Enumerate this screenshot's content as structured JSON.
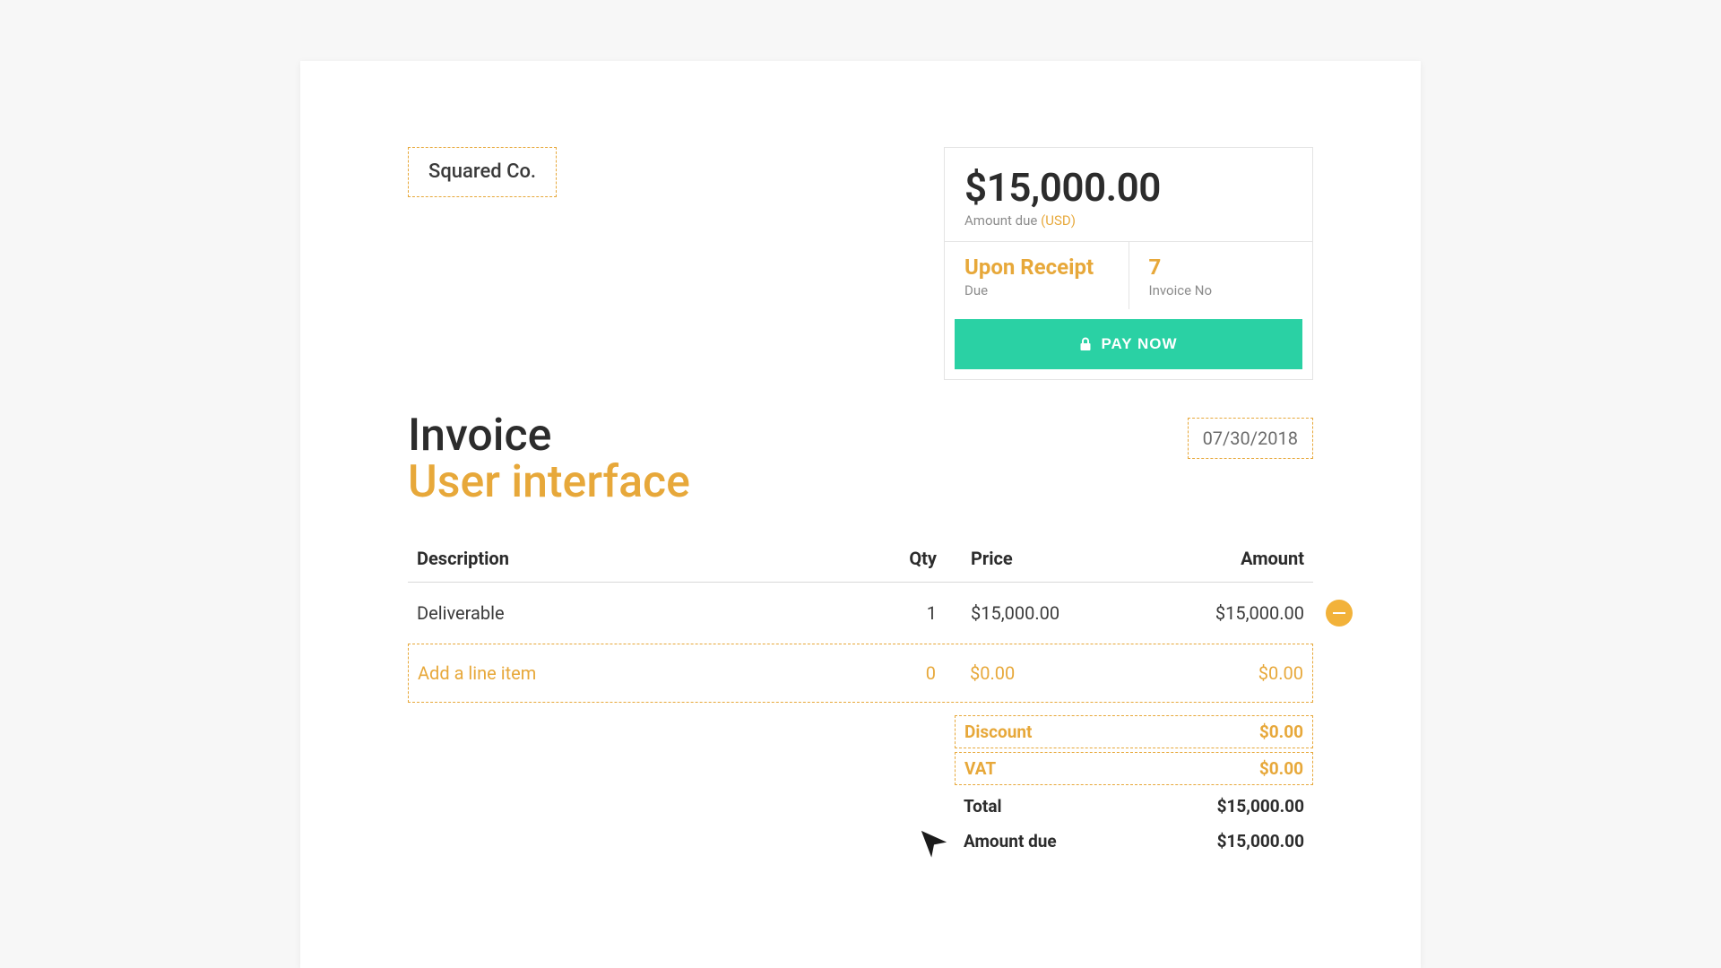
{
  "company_name": "Squared Co.",
  "summary": {
    "amount_big": "$15,000.00",
    "amount_due_label": "Amount due",
    "currency": "(USD)",
    "due_value": "Upon Receipt",
    "due_label": "Due",
    "invoice_no_value": "7",
    "invoice_no_label": "Invoice No",
    "pay_label": "PAY NOW"
  },
  "title": {
    "heading": "Invoice",
    "subheading": "User interface",
    "date": "07/30/2018"
  },
  "table": {
    "headers": {
      "description": "Description",
      "qty": "Qty",
      "price": "Price",
      "amount": "Amount"
    },
    "row": {
      "description": "Deliverable",
      "qty": "1",
      "price": "$15,000.00",
      "amount": "$15,000.00"
    },
    "add": {
      "label": "Add a line item",
      "qty": "0",
      "price": "$0.00",
      "amount": "$0.00"
    }
  },
  "totals": {
    "discount_label": "Discount",
    "discount_value": "$0.00",
    "vat_label": "VAT",
    "vat_value": "$0.00",
    "total_label": "Total",
    "total_value": "$15,000.00",
    "amount_due_label": "Amount due",
    "amount_due_value": "$15,000.00"
  }
}
